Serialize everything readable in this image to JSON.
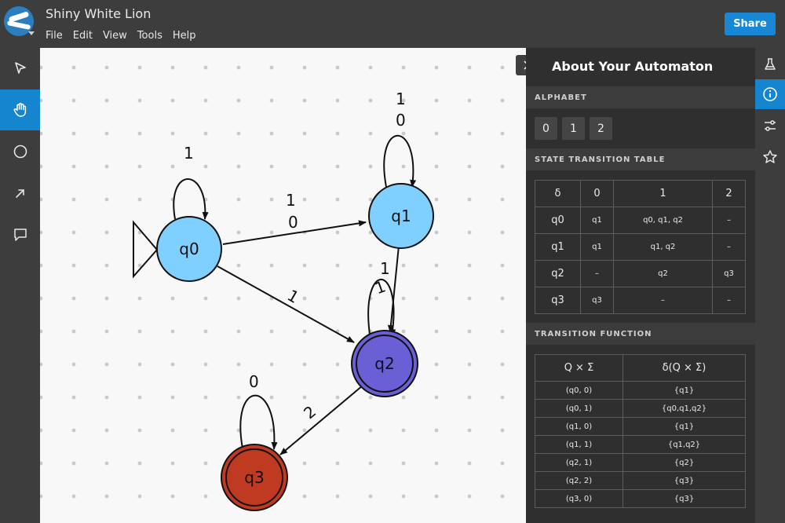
{
  "app": {
    "title": "Shiny White Lion",
    "menu": [
      "File",
      "Edit",
      "View",
      "Tools",
      "Help"
    ],
    "share_label": "Share"
  },
  "colors": {
    "accent": "#1787d6",
    "state_default": "#7fcfff",
    "state_q2": "#6a5fd4",
    "state_q3": "#c03a22"
  },
  "automaton": {
    "states": [
      {
        "id": "q0",
        "label": "q0",
        "initial": true,
        "accepting": false
      },
      {
        "id": "q1",
        "label": "q1",
        "initial": false,
        "accepting": false
      },
      {
        "id": "q2",
        "label": "q2",
        "initial": false,
        "accepting": true
      },
      {
        "id": "q3",
        "label": "q3",
        "initial": false,
        "accepting": true
      }
    ],
    "edge_labels": {
      "q0_self": "1",
      "q0_q1_top": "1",
      "q0_q1_bottom": "0",
      "q1_self_top": "1",
      "q1_self_bottom": "0",
      "q0_q2": "1",
      "q1_q2": "1",
      "q2_self": "1",
      "q2_q3": "2",
      "q3_self": "0"
    }
  },
  "panel": {
    "title": "About Your Automaton",
    "alphabet_heading": "ALPHABET",
    "alphabet": [
      "0",
      "1",
      "2"
    ],
    "stt_heading": "STATE TRANSITION TABLE",
    "stt": {
      "header": [
        "δ",
        "0",
        "1",
        "2"
      ],
      "rows": [
        [
          "q0",
          "q1",
          "q0, q1, q2",
          "–"
        ],
        [
          "q1",
          "q1",
          "q1, q2",
          "–"
        ],
        [
          "q2",
          "–",
          "q2",
          "q3"
        ],
        [
          "q3",
          "q3",
          "–",
          "–"
        ]
      ]
    },
    "tf_heading": "TRANSITION FUNCTION",
    "tf": {
      "header": [
        "Q × Σ",
        "δ(Q × Σ)"
      ],
      "rows": [
        [
          "(q0, 0)",
          "{q1}"
        ],
        [
          "(q0, 1)",
          "{q0,q1,q2}"
        ],
        [
          "(q1, 0)",
          "{q1}"
        ],
        [
          "(q1, 1)",
          "{q1,q2}"
        ],
        [
          "(q2, 1)",
          "{q2}"
        ],
        [
          "(q2, 2)",
          "{q3}"
        ],
        [
          "(q3, 0)",
          "{q3}"
        ]
      ]
    }
  },
  "icons": {
    "left_tools": [
      "cursor-icon",
      "hand-icon",
      "circle-icon",
      "arrow-icon",
      "comment-icon"
    ],
    "right_tools": [
      "flask-icon",
      "info-icon",
      "sliders-icon",
      "star-icon"
    ]
  }
}
